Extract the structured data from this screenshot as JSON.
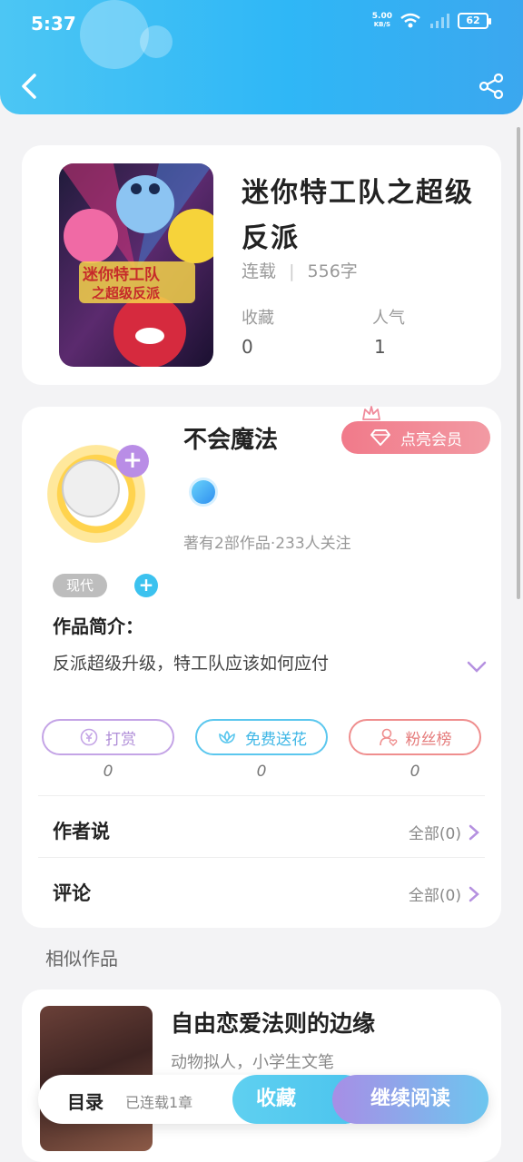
{
  "status_bar": {
    "time": "5:37",
    "net_speed": "5.00",
    "net_unit": "KB/S",
    "battery": "62"
  },
  "book": {
    "title": "迷你特工队之超级反派",
    "status": "连载",
    "word_count": "556字",
    "stats": [
      {
        "label": "收藏",
        "value": "0"
      },
      {
        "label": "人气",
        "value": "1"
      }
    ],
    "cover_text_1": "迷你特工队",
    "cover_text_2": "之超级反派"
  },
  "author": {
    "name": "不会魔法",
    "vip_label": "点亮会员",
    "stats_text": "著有2部作品·233人关注",
    "tag": "现代",
    "intro_label": "作品简介：",
    "intro_text": "反派超级升级，特工队应该如何应付"
  },
  "actions": [
    {
      "label": "打赏",
      "count": "0",
      "color": "#c4a4e6"
    },
    {
      "label": "免费送花",
      "count": "0",
      "color": "#5bc7ee"
    },
    {
      "label": "粉丝榜",
      "count": "0",
      "color": "#ef8e8e"
    }
  ],
  "rows": [
    {
      "label": "作者说",
      "link": "全部(0)"
    },
    {
      "label": "评论",
      "link": "全部(0)"
    }
  ],
  "similar": {
    "section_title": "相似作品",
    "title": "自由恋爱法则的边缘",
    "desc": "动物拟人，小学生文笔"
  },
  "bottom_bar": {
    "toc_label": "目录",
    "toc_status": "已连载1章",
    "favorite_label": "收藏",
    "read_label": "继续阅读"
  }
}
